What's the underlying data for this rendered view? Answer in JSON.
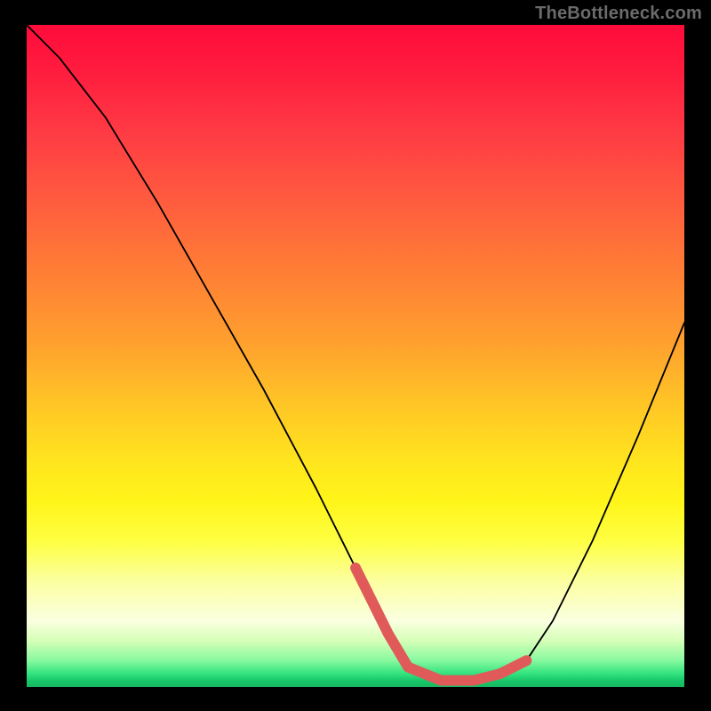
{
  "watermark": "TheBottleneck.com",
  "chart_data": {
    "type": "line",
    "title": "",
    "xlabel": "",
    "ylabel": "",
    "xlim": [
      0,
      100
    ],
    "ylim": [
      0,
      100
    ],
    "series": [
      {
        "name": "bottleneck-curve",
        "x": [
          0,
          5,
          12,
          20,
          28,
          36,
          44,
          52,
          55,
          58,
          63,
          68,
          72,
          76,
          80,
          86,
          93,
          100
        ],
        "values": [
          100,
          95,
          86,
          73,
          59,
          45,
          30,
          14,
          8,
          3,
          1,
          1,
          2,
          4,
          10,
          22,
          38,
          55
        ]
      }
    ],
    "marker_segment": {
      "name": "optimal-range-marker",
      "color": "#e05a5a",
      "x": [
        50,
        52,
        55,
        58,
        63,
        68,
        72,
        76
      ],
      "values": [
        18,
        14,
        8,
        3,
        1,
        1,
        2,
        4
      ]
    }
  }
}
